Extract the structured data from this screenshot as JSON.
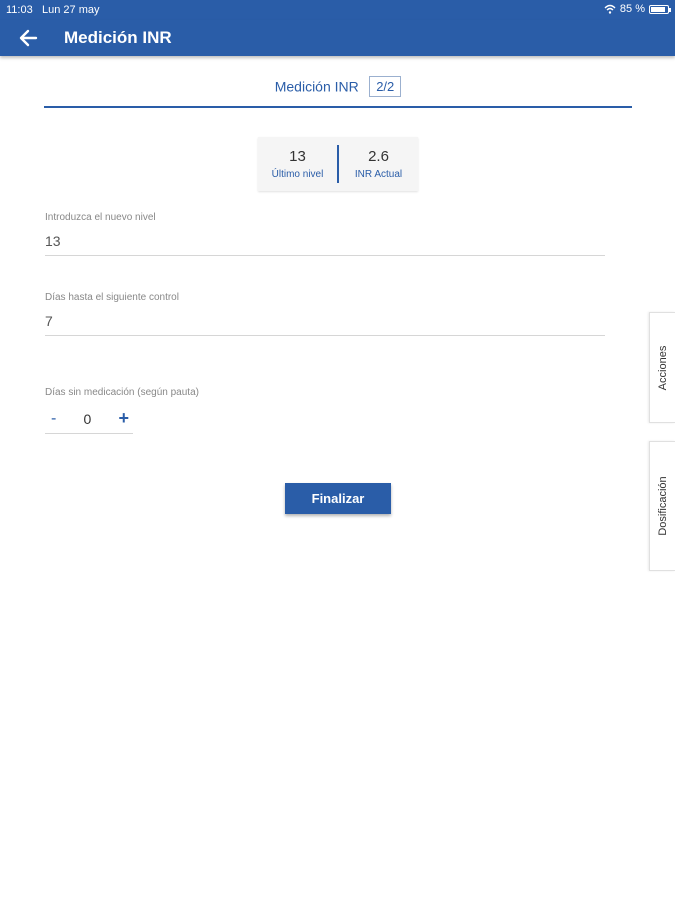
{
  "status": {
    "time": "11:03",
    "date": "Lun 27 may",
    "battery": "85 %",
    "battery_level": 0.85
  },
  "appbar": {
    "title": "Medición INR"
  },
  "step": {
    "label": "Medición INR",
    "indicator": "2/2"
  },
  "stats": [
    {
      "value": "13",
      "label": "Último nivel"
    },
    {
      "value": "2.6",
      "label": "INR Actual"
    }
  ],
  "fields": {
    "level": {
      "label": "Introduzca el nuevo nivel",
      "value": "13"
    },
    "days": {
      "label": "Días hasta el siguiente control",
      "value": "7"
    }
  },
  "stepper": {
    "label": "Días sin medicación (según pauta)",
    "minus": "-",
    "value": "0",
    "plus": "+"
  },
  "finalize_label": "Finalizar",
  "side_tabs": {
    "actions": "Acciones",
    "dosing": "Dosificación"
  },
  "colors": {
    "primary": "#2a5da8"
  }
}
